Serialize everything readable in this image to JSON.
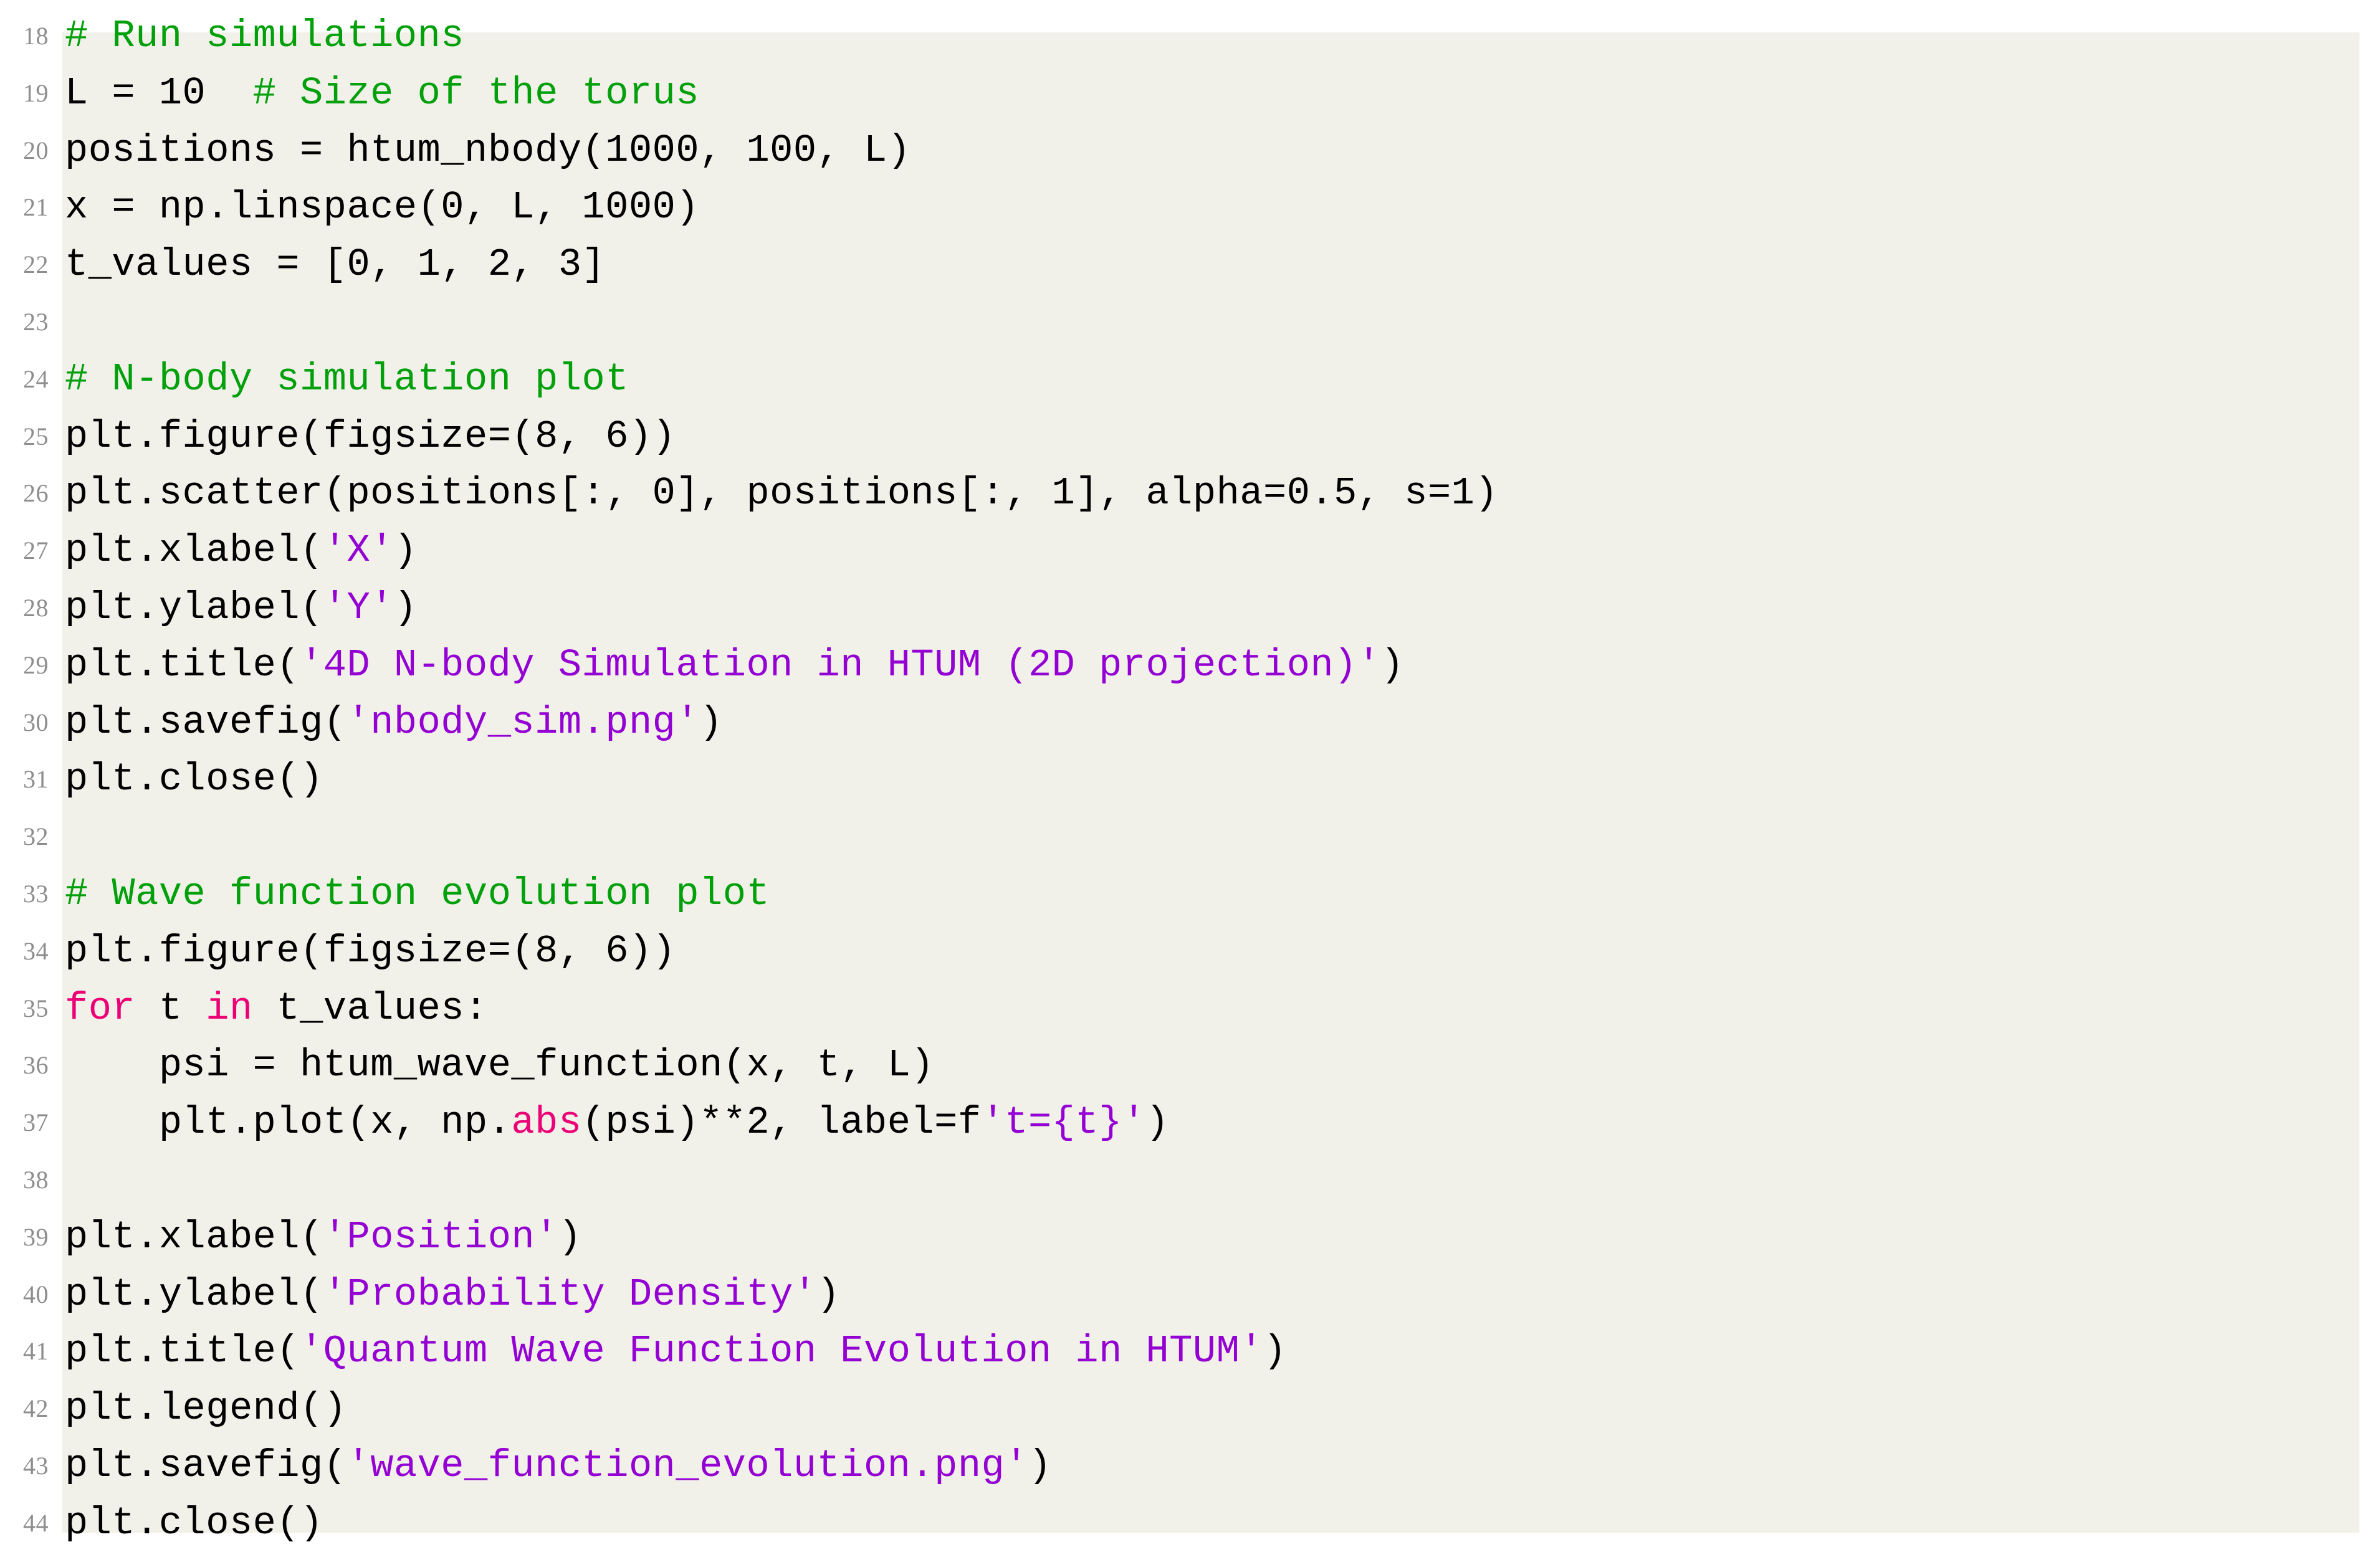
{
  "listing": {
    "language": "Python",
    "colors": {
      "background": "#f1f1e9",
      "page": "#ffffff",
      "line_number": "#8d8d8d",
      "comment": "#00a00a",
      "string": "#9400d3",
      "keyword": "#eb0076",
      "plain": "#000000"
    },
    "first_line_number": 18,
    "last_line_number": 44,
    "lines": [
      {
        "n": "18",
        "tokens": [
          {
            "t": "comment",
            "s": "# Run simulations"
          }
        ]
      },
      {
        "n": "19",
        "tokens": [
          {
            "t": "plain",
            "s": "L = 10  "
          },
          {
            "t": "comment",
            "s": "# Size of the torus"
          }
        ]
      },
      {
        "n": "20",
        "tokens": [
          {
            "t": "plain",
            "s": "positions = htum_nbody(1000, 100, L)"
          }
        ]
      },
      {
        "n": "21",
        "tokens": [
          {
            "t": "plain",
            "s": "x = np.linspace(0, L, 1000)"
          }
        ]
      },
      {
        "n": "22",
        "tokens": [
          {
            "t": "plain",
            "s": "t_values = [0, 1, 2, 3]"
          }
        ]
      },
      {
        "n": "23",
        "tokens": [
          {
            "t": "plain",
            "s": ""
          }
        ]
      },
      {
        "n": "24",
        "tokens": [
          {
            "t": "comment",
            "s": "# N-body simulation plot"
          }
        ]
      },
      {
        "n": "25",
        "tokens": [
          {
            "t": "plain",
            "s": "plt.figure(figsize=(8, 6))"
          }
        ]
      },
      {
        "n": "26",
        "tokens": [
          {
            "t": "plain",
            "s": "plt.scatter(positions[:, 0], positions[:, 1], alpha=0.5, s=1)"
          }
        ]
      },
      {
        "n": "27",
        "tokens": [
          {
            "t": "plain",
            "s": "plt.xlabel("
          },
          {
            "t": "string",
            "s": "'X'"
          },
          {
            "t": "plain",
            "s": ")"
          }
        ]
      },
      {
        "n": "28",
        "tokens": [
          {
            "t": "plain",
            "s": "plt.ylabel("
          },
          {
            "t": "string",
            "s": "'Y'"
          },
          {
            "t": "plain",
            "s": ")"
          }
        ]
      },
      {
        "n": "29",
        "tokens": [
          {
            "t": "plain",
            "s": "plt.title("
          },
          {
            "t": "string",
            "s": "'4D N-body Simulation in HTUM (2D projection)'"
          },
          {
            "t": "plain",
            "s": ")"
          }
        ]
      },
      {
        "n": "30",
        "tokens": [
          {
            "t": "plain",
            "s": "plt.savefig("
          },
          {
            "t": "string",
            "s": "'nbody_sim.png'"
          },
          {
            "t": "plain",
            "s": ")"
          }
        ]
      },
      {
        "n": "31",
        "tokens": [
          {
            "t": "plain",
            "s": "plt.close()"
          }
        ]
      },
      {
        "n": "32",
        "tokens": [
          {
            "t": "plain",
            "s": ""
          }
        ]
      },
      {
        "n": "33",
        "tokens": [
          {
            "t": "comment",
            "s": "# Wave function evolution plot"
          }
        ]
      },
      {
        "n": "34",
        "tokens": [
          {
            "t": "plain",
            "s": "plt.figure(figsize=(8, 6))"
          }
        ]
      },
      {
        "n": "35",
        "tokens": [
          {
            "t": "keyword",
            "s": "for"
          },
          {
            "t": "plain",
            "s": " t "
          },
          {
            "t": "keyword",
            "s": "in"
          },
          {
            "t": "plain",
            "s": " t_values:"
          }
        ]
      },
      {
        "n": "36",
        "tokens": [
          {
            "t": "plain",
            "s": "    psi = htum_wave_function(x, t, L)"
          }
        ]
      },
      {
        "n": "37",
        "tokens": [
          {
            "t": "plain",
            "s": "    plt.plot(x, np."
          },
          {
            "t": "keyword",
            "s": "abs"
          },
          {
            "t": "plain",
            "s": "(psi)**2, label=f"
          },
          {
            "t": "string",
            "s": "'t={t}'"
          },
          {
            "t": "plain",
            "s": ")"
          }
        ]
      },
      {
        "n": "38",
        "tokens": [
          {
            "t": "plain",
            "s": ""
          }
        ]
      },
      {
        "n": "39",
        "tokens": [
          {
            "t": "plain",
            "s": "plt.xlabel("
          },
          {
            "t": "string",
            "s": "'Position'"
          },
          {
            "t": "plain",
            "s": ")"
          }
        ]
      },
      {
        "n": "40",
        "tokens": [
          {
            "t": "plain",
            "s": "plt.ylabel("
          },
          {
            "t": "string",
            "s": "'Probability Density'"
          },
          {
            "t": "plain",
            "s": ")"
          }
        ]
      },
      {
        "n": "41",
        "tokens": [
          {
            "t": "plain",
            "s": "plt.title("
          },
          {
            "t": "string",
            "s": "'Quantum Wave Function Evolution in HTUM'"
          },
          {
            "t": "plain",
            "s": ")"
          }
        ]
      },
      {
        "n": "42",
        "tokens": [
          {
            "t": "plain",
            "s": "plt.legend()"
          }
        ]
      },
      {
        "n": "43",
        "tokens": [
          {
            "t": "plain",
            "s": "plt.savefig("
          },
          {
            "t": "string",
            "s": "'wave_function_evolution.png'"
          },
          {
            "t": "plain",
            "s": ")"
          }
        ]
      },
      {
        "n": "44",
        "tokens": [
          {
            "t": "plain",
            "s": "plt.close()"
          }
        ]
      }
    ]
  }
}
